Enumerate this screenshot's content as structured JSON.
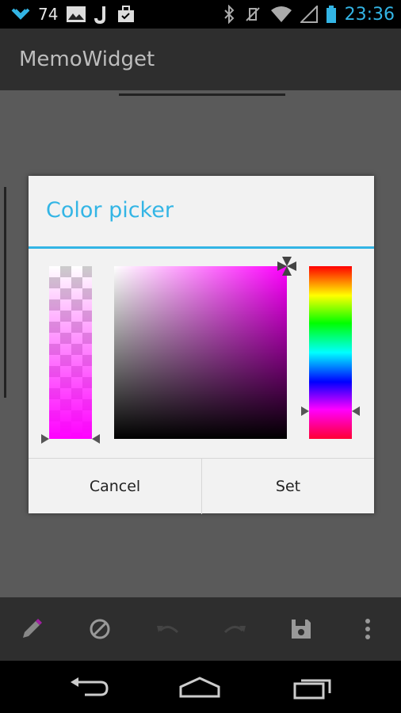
{
  "status_bar": {
    "notification_count": "74",
    "clock": "23:36",
    "left_icons": [
      "signal-chevron-icon",
      "image-icon",
      "j-app-icon",
      "briefcase-icon"
    ],
    "right_icons": [
      "bluetooth-icon",
      "vibrate-off-icon",
      "wifi-icon",
      "cell-signal-icon",
      "battery-icon"
    ]
  },
  "action_bar": {
    "title": "MemoWidget"
  },
  "dialog": {
    "title": "Color picker",
    "selected_color": "#ff00ff",
    "alpha_level": 1.0,
    "hue_level": 0.83,
    "cancel_label": "Cancel",
    "set_label": "Set"
  },
  "toolbar": {
    "items": [
      "pen-icon",
      "eraser-icon",
      "undo-icon",
      "redo-icon",
      "save-icon",
      "overflow-menu-icon"
    ]
  },
  "nav": {
    "items": [
      "back-icon",
      "home-icon",
      "recents-icon"
    ]
  },
  "colors": {
    "accent": "#33b5e5",
    "pen_tip": "#a020a0"
  }
}
